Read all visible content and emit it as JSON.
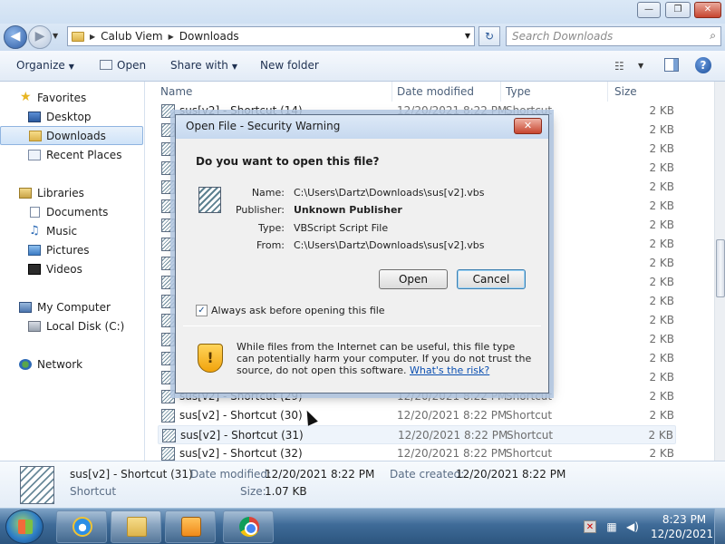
{
  "window": {
    "controls": {
      "minimize": "—",
      "maximize": "❐",
      "close": "✕"
    }
  },
  "address": {
    "segments": [
      "Calub Viem",
      "Downloads"
    ],
    "search_placeholder": "Search Downloads"
  },
  "toolbar": {
    "organize": "Organize",
    "open": "Open",
    "share_with": "Share with",
    "new_folder": "New folder"
  },
  "nav": {
    "favorites": "Favorites",
    "desktop": "Desktop",
    "downloads": "Downloads",
    "recent_places": "Recent Places",
    "libraries": "Libraries",
    "documents": "Documents",
    "music": "Music",
    "pictures": "Pictures",
    "videos": "Videos",
    "my_computer": "My Computer",
    "local_disk": "Local Disk (C:)",
    "network": "Network"
  },
  "columns": {
    "name": "Name",
    "date_modified": "Date modified",
    "type": "Type",
    "size": "Size"
  },
  "files": [
    {
      "name": "sus[v2] - Shortcut (14)",
      "date": "12/20/2021 8:22 PM",
      "type": "Shortcut",
      "size": "2 KB"
    },
    {
      "name": "",
      "date": "",
      "type": "",
      "size": "2 KB"
    },
    {
      "name": "",
      "date": "",
      "type": "",
      "size": "2 KB"
    },
    {
      "name": "",
      "date": "",
      "type": "",
      "size": "2 KB"
    },
    {
      "name": "",
      "date": "",
      "type": "",
      "size": "2 KB"
    },
    {
      "name": "",
      "date": "",
      "type": "",
      "size": "2 KB"
    },
    {
      "name": "",
      "date": "",
      "type": "",
      "size": "2 KB"
    },
    {
      "name": "",
      "date": "",
      "type": "",
      "size": "2 KB"
    },
    {
      "name": "",
      "date": "",
      "type": "",
      "size": "2 KB"
    },
    {
      "name": "",
      "date": "",
      "type": "",
      "size": "2 KB"
    },
    {
      "name": "",
      "date": "",
      "type": "",
      "size": "2 KB"
    },
    {
      "name": "",
      "date": "",
      "type": "",
      "size": "2 KB"
    },
    {
      "name": "",
      "date": "",
      "type": "",
      "size": "2 KB"
    },
    {
      "name": "",
      "date": "",
      "type": "",
      "size": "2 KB"
    },
    {
      "name": "",
      "date": "",
      "type": "",
      "size": "2 KB"
    },
    {
      "name": "sus[v2] - Shortcut (29)",
      "date": "12/20/2021 8:22 PM",
      "type": "Shortcut",
      "size": "2 KB"
    },
    {
      "name": "sus[v2] - Shortcut (30)",
      "date": "12/20/2021 8:22 PM",
      "type": "Shortcut",
      "size": "2 KB"
    },
    {
      "name": "sus[v2] - Shortcut (31)",
      "date": "12/20/2021 8:22 PM",
      "type": "Shortcut",
      "size": "2 KB"
    },
    {
      "name": "sus[v2] - Shortcut (32)",
      "date": "12/20/2021 8:22 PM",
      "type": "Shortcut",
      "size": "2 KB"
    }
  ],
  "details": {
    "name": "sus[v2] - Shortcut (31)",
    "type": "Shortcut",
    "date_modified_label": "Date modified:",
    "date_modified": "12/20/2021 8:22 PM",
    "date_created_label": "Date created:",
    "date_created": "12/20/2021 8:22 PM",
    "size_label": "Size:",
    "size": "1.07 KB"
  },
  "dialog": {
    "title": "Open File - Security Warning",
    "question": "Do you want to open this file?",
    "fields": [
      {
        "label": "Name:",
        "value": "C:\\Users\\Dartz\\Downloads\\sus[v2].vbs"
      },
      {
        "label": "Publisher:",
        "value": "Unknown Publisher"
      },
      {
        "label": "Type:",
        "value": "VBScript Script File"
      },
      {
        "label": "From:",
        "value": "C:\\Users\\Dartz\\Downloads\\sus[v2].vbs"
      }
    ],
    "open_button": "Open",
    "cancel_button": "Cancel",
    "always_ask": "Always ask before opening this file",
    "always_ask_checked": true,
    "warning_text": "While files from the Internet can be useful, this file type can potentially harm your computer. If you do not trust the source, do not open this software.",
    "risk_link": "What's the risk?"
  },
  "taskbar": {
    "time": "8:23 PM",
    "date": "12/20/2021"
  }
}
